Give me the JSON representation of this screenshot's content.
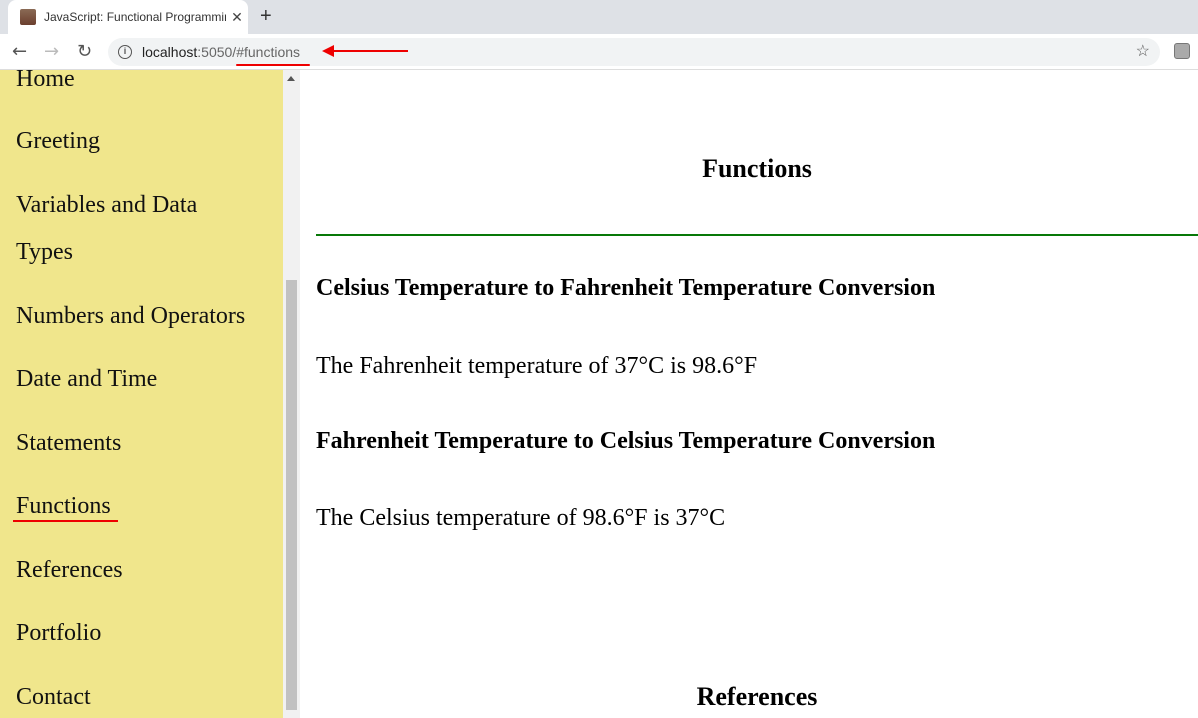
{
  "browser": {
    "tab_title": "JavaScript: Functional Programming",
    "url_host": "localhost",
    "url_path": ":5050/#functions",
    "new_tab": "+",
    "close": "✕"
  },
  "sidebar": {
    "items": [
      {
        "label": "Home"
      },
      {
        "label": "Greeting"
      },
      {
        "label": "Variables and Data"
      },
      {
        "label": "Types"
      },
      {
        "label": "Numbers and Operators"
      },
      {
        "label": "Date and Time"
      },
      {
        "label": "Statements"
      },
      {
        "label": "Functions"
      },
      {
        "label": "References"
      },
      {
        "label": "Portfolio"
      },
      {
        "label": "Contact"
      }
    ]
  },
  "main": {
    "section_title": "Functions",
    "c2f_heading": "Celsius Temperature to Fahrenheit Temperature Conversion",
    "c2f_result": "The Fahrenheit temperature of 37°C is 98.6°F",
    "f2c_heading": "Fahrenheit Temperature to Celsius Temperature Conversion",
    "f2c_result": "The Celsius temperature of 98.6°F is 37°C",
    "next_section_title": "References"
  },
  "colors": {
    "sidebar_bg": "#f0e68c",
    "divider": "#087808",
    "annotation": "#e00000"
  }
}
